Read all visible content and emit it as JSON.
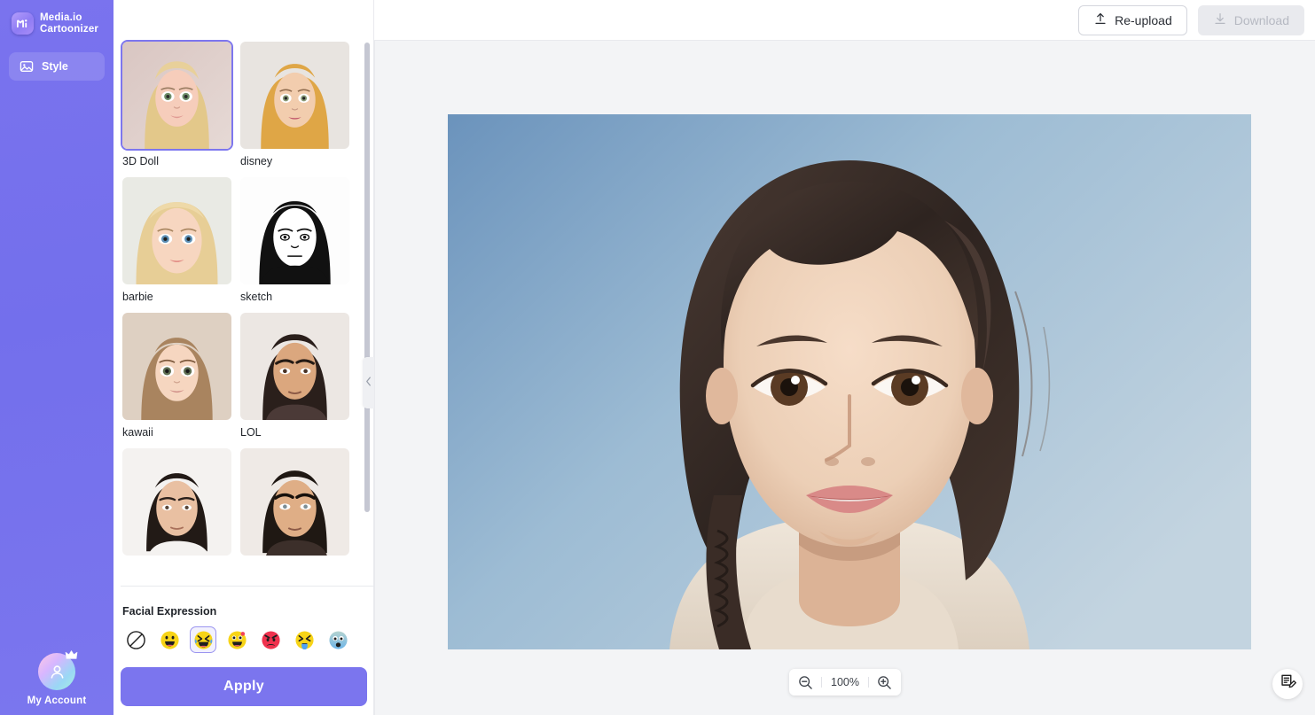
{
  "brand": {
    "line1": "Media.io",
    "line2": "Cartoonizer",
    "logo_icon": "media-io-logo-icon"
  },
  "sidebar": {
    "nav": [
      {
        "label": "Style",
        "icon": "image-icon",
        "active": true
      }
    ],
    "account": {
      "label": "My Account",
      "icon": "user-avatar-icon",
      "badge_icon": "crown-icon"
    },
    "bg_color": "#7b75ee"
  },
  "topbar": {
    "reupload_label": "Re-upload",
    "reupload_icon": "upload-icon",
    "download_label": "Download",
    "download_icon": "download-icon",
    "download_disabled": true
  },
  "panel": {
    "styles": [
      {
        "label": "3D Doll",
        "selected": true
      },
      {
        "label": "disney",
        "selected": false
      },
      {
        "label": "barbie",
        "selected": false
      },
      {
        "label": "sketch",
        "selected": false
      },
      {
        "label": "kawaii",
        "selected": false
      },
      {
        "label": "LOL",
        "selected": false
      },
      {
        "label": "",
        "selected": false
      },
      {
        "label": "",
        "selected": false
      }
    ],
    "expression_title": "Facial Expression",
    "expressions": [
      {
        "name": "none",
        "icon": "no-expression-icon",
        "selected": false
      },
      {
        "name": "grinning",
        "icon": "grinning-face-icon",
        "selected": false
      },
      {
        "name": "laughing",
        "icon": "laughing-tears-face-icon",
        "selected": true
      },
      {
        "name": "excited",
        "icon": "star-struck-face-icon",
        "selected": false
      },
      {
        "name": "angry",
        "icon": "angry-face-icon",
        "selected": false
      },
      {
        "name": "crying",
        "icon": "crying-face-icon",
        "selected": false
      },
      {
        "name": "fearful",
        "icon": "fearful-face-icon",
        "selected": false
      }
    ],
    "apply_label": "Apply",
    "collapse_icon": "chevron-left-icon",
    "accent_color": "#7b75ee"
  },
  "canvas": {
    "zoom_value": "100%",
    "zoom_out_icon": "zoom-out-icon",
    "zoom_in_icon": "zoom-in-icon",
    "feedback_icon": "feedback-edit-icon",
    "photo_alt": "portrait-of-young-girl",
    "bg_color": "#f3f4f6"
  }
}
